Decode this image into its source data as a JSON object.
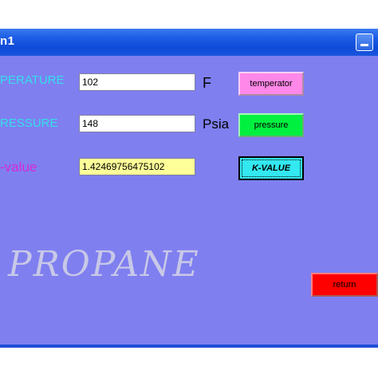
{
  "window": {
    "title": "n1"
  },
  "fields": {
    "temperature": {
      "label": "PERATURE",
      "value": "102",
      "unit": "F",
      "button": "temperator"
    },
    "pressure": {
      "label": "RESSURE",
      "value": "148",
      "unit": "Psia",
      "button": "pressure"
    },
    "k_value": {
      "label": "-value",
      "value": "1.42469756475102",
      "button": "K-VALUE"
    }
  },
  "branding": {
    "text": "PROPANE"
  },
  "actions": {
    "return_label": "return"
  },
  "colors": {
    "form_background": "#7f7ff0",
    "title_bar": "#1f5fe6",
    "label_cyan": "#33e0e8",
    "label_magenta": "#d62ad6",
    "temperature_button": "#ff88e8",
    "pressure_button": "#00f040",
    "k_value_button": "#33e8f0",
    "return_button": "#ff0000",
    "k_value_field": "#ffff99"
  },
  "icons": {
    "minimize": "minimize-icon"
  }
}
